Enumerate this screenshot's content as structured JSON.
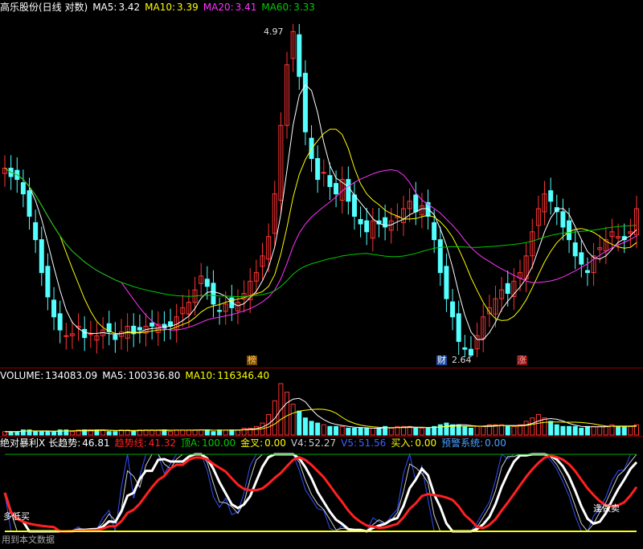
{
  "main_header": {
    "stock_name": "高乐股份(日线 对数)",
    "ma5_label": "MA5:",
    "ma5_value": "3.42",
    "ma10_label": "MA10:",
    "ma10_value": "3.39",
    "ma20_label": "MA20:",
    "ma20_value": "3.41",
    "ma60_label": "MA60:",
    "ma60_value": "3.33"
  },
  "volume_header": {
    "label": "VOLUME:",
    "value": "134083.09",
    "ma5_label": "MA5:",
    "ma5_value": "100336.80",
    "ma10_label": "MA10:",
    "ma10_value": "116346.40"
  },
  "indicator_header": {
    "name": "绝对暴利X",
    "long_trend_label": "长趋势:",
    "long_trend_value": "46.81",
    "trend_line_label": "趋势线:",
    "trend_line_value": "41.32",
    "top_a_label": "顶A:",
    "top_a_value": "100.00",
    "golden_cross_label": "金叉:",
    "golden_cross_value": "0.00",
    "v4_label": "V4:",
    "v4_value": "52.27",
    "v5_label": "V5:",
    "v5_value": "51.56",
    "buy_label": "买入:",
    "buy_value": "0.00",
    "warning_label": "预警系统:",
    "warning_value": "0.00"
  },
  "annotations": {
    "high_price": "4.97",
    "low_price": "2.64",
    "marker_bang": "榜",
    "marker_cai": "财",
    "marker_zhang": "涨",
    "buy_text": "多低买",
    "sell_text": "逢做卖",
    "footer_text": "用到本文数据"
  },
  "colors": {
    "up": "#ff3333",
    "down": "#54ffff",
    "ma5": "#ffffff",
    "ma10": "#ffff00",
    "ma20": "#ff33ff",
    "ma60": "#00cc00",
    "trend_red": "#ff2020",
    "trend_white": "#ffffff",
    "signal_yellow": "#ffff00"
  },
  "chart_data": {
    "type": "candlestick",
    "price_scale": "log",
    "high_marked": 4.97,
    "low_marked": 2.64,
    "series_names": [
      "MA5",
      "MA10",
      "MA20",
      "MA60"
    ],
    "closes": [
      3.78,
      3.72,
      3.7,
      3.6,
      3.45,
      3.3,
      3.1,
      2.96,
      2.85,
      2.78,
      2.75,
      2.76,
      2.8,
      2.74,
      2.76,
      2.75,
      2.78,
      2.77,
      2.73,
      2.77,
      2.8,
      2.76,
      2.78,
      2.8,
      2.8,
      2.81,
      2.79,
      2.8,
      2.85,
      2.9,
      2.93,
      3.0,
      3.08,
      3.02,
      2.92,
      2.88,
      2.92,
      2.9,
      2.93,
      2.98,
      3.05,
      3.1,
      3.2,
      3.32,
      3.6,
      4.1,
      4.6,
      4.9,
      4.5,
      4.05,
      3.85,
      3.7,
      3.75,
      3.65,
      3.6,
      3.7,
      3.55,
      3.45,
      3.4,
      3.35,
      3.42,
      3.4,
      3.38,
      3.42,
      3.45,
      3.5,
      3.55,
      3.48,
      3.52,
      3.45,
      3.3,
      3.1,
      2.95,
      2.85,
      2.72,
      2.68,
      2.65,
      2.75,
      2.85,
      2.9,
      2.95,
      3.0,
      2.98,
      3.05,
      3.1,
      3.2,
      3.35,
      3.5,
      3.6,
      3.55,
      3.48,
      3.38,
      3.3,
      3.2,
      3.15,
      3.1,
      3.2,
      3.25,
      3.3,
      3.35,
      3.32,
      3.3,
      3.35,
      3.5
    ],
    "volumes": [
      2,
      2,
      2,
      3,
      3,
      2,
      2,
      2,
      2,
      3,
      3,
      2,
      3,
      3,
      3,
      3,
      3,
      2,
      2,
      3,
      3,
      2,
      3,
      3,
      3,
      3,
      3,
      2,
      3,
      3,
      3,
      3,
      3,
      3,
      2,
      3,
      3,
      3,
      3,
      4,
      4,
      5,
      7,
      12,
      20,
      30,
      25,
      18,
      14,
      10,
      8,
      7,
      6,
      5,
      5,
      5,
      4,
      4,
      4,
      4,
      4,
      4,
      5,
      4,
      5,
      5,
      5,
      4,
      4,
      4,
      5,
      6,
      7,
      6,
      6,
      5,
      4,
      5,
      5,
      6,
      6,
      6,
      5,
      5,
      6,
      8,
      10,
      12,
      10,
      8,
      6,
      5,
      5,
      5,
      4,
      5,
      5,
      5,
      5,
      6,
      5,
      5,
      5,
      6
    ]
  }
}
